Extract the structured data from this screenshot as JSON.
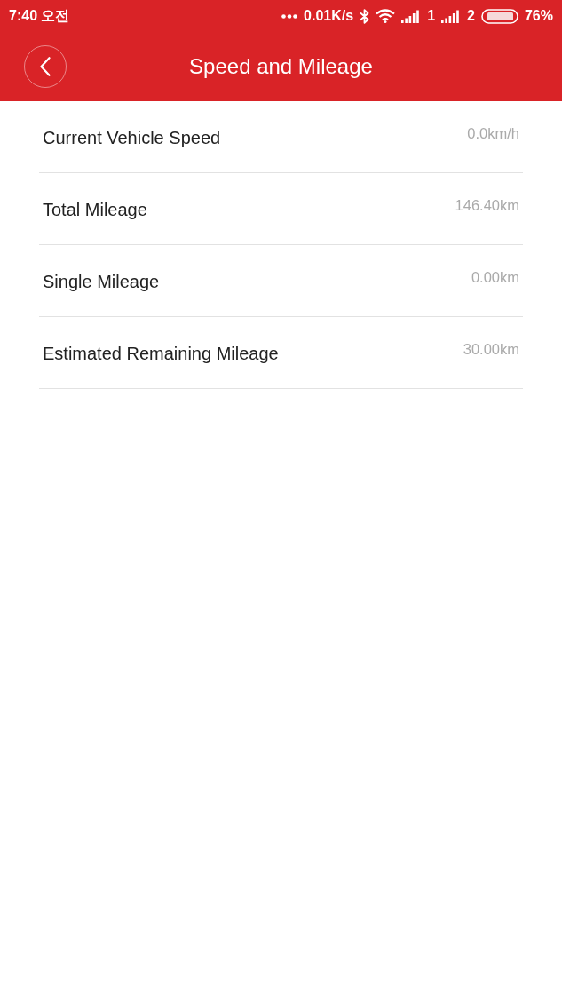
{
  "status_bar": {
    "time": "7:40 오전",
    "network_speed": "0.01K/s",
    "sim_1_label": "1",
    "sim_2_label": "2",
    "battery": "76%"
  },
  "header": {
    "title": "Speed and Mileage"
  },
  "rows": [
    {
      "label": "Current Vehicle Speed",
      "value": "0.0km/h"
    },
    {
      "label": "Total Mileage",
      "value": "146.40km"
    },
    {
      "label": "Single Mileage",
      "value": "0.00km"
    },
    {
      "label": "Estimated Remaining Mileage",
      "value": "30.00km"
    }
  ]
}
